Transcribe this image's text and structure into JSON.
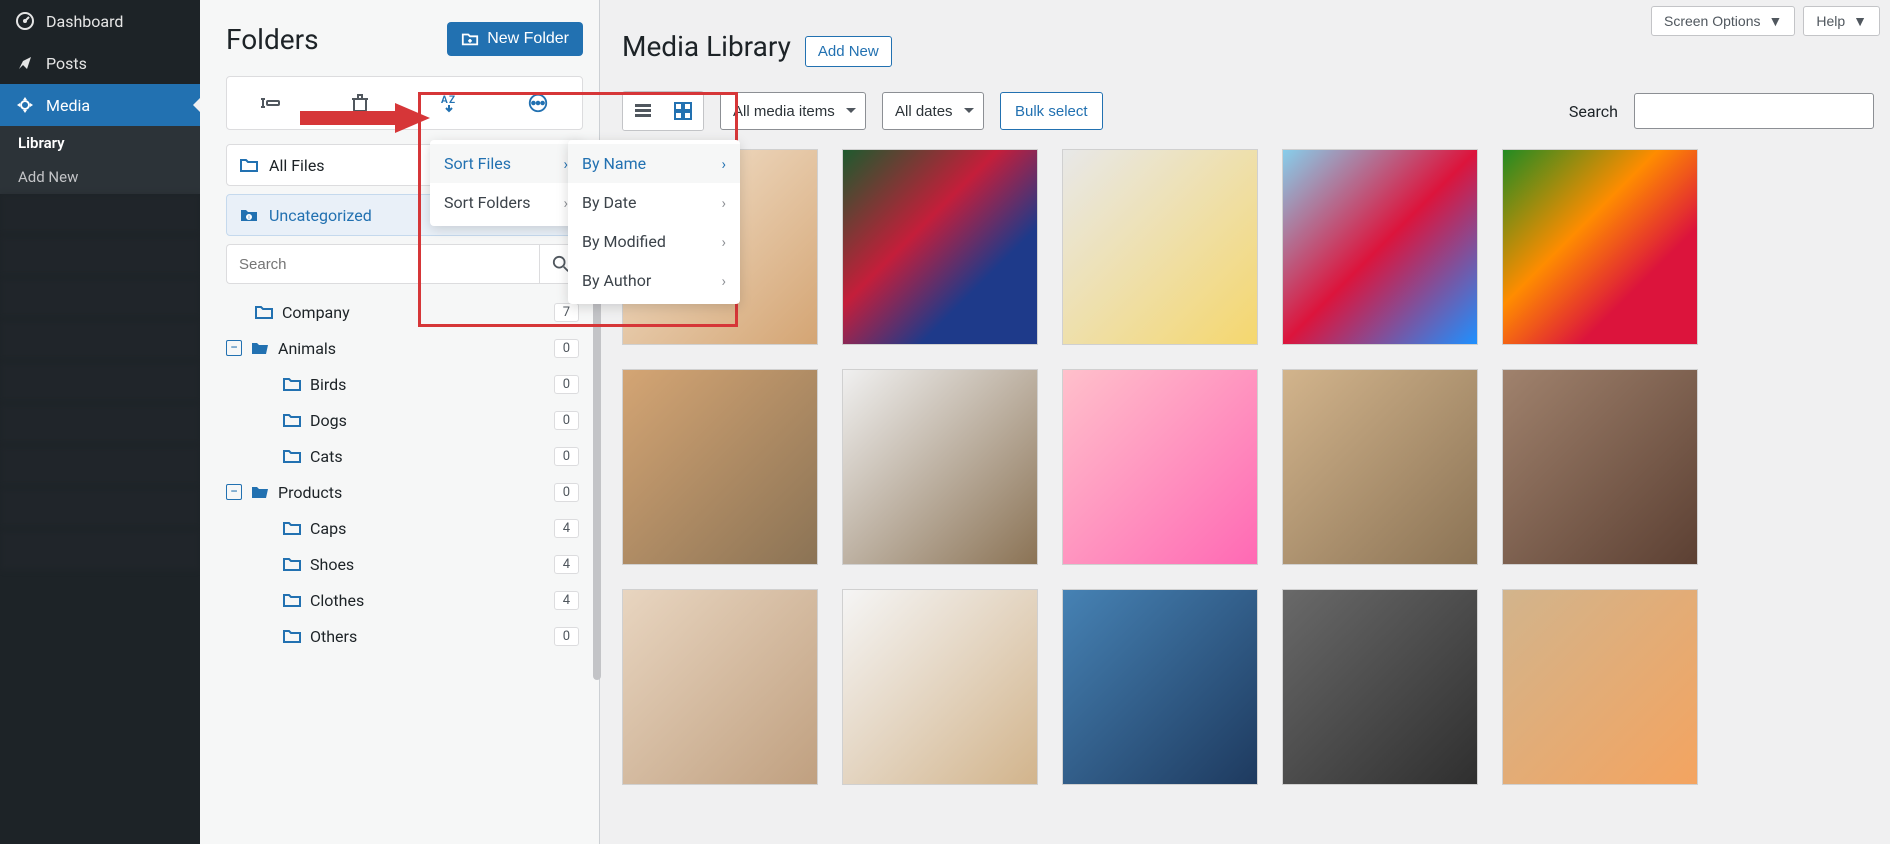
{
  "admin_menu": {
    "dashboard": "Dashboard",
    "posts": "Posts",
    "media": "Media",
    "library": "Library",
    "add_new": "Add New"
  },
  "folders": {
    "title": "Folders",
    "new_folder_btn": "New Folder",
    "all_files": "All Files",
    "uncategorized": "Uncategorized",
    "search_placeholder": "Search",
    "tree": {
      "company": {
        "label": "Company",
        "count": "7"
      },
      "animals": {
        "label": "Animals",
        "count": "0"
      },
      "birds": {
        "label": "Birds",
        "count": "0"
      },
      "dogs": {
        "label": "Dogs",
        "count": "0"
      },
      "cats": {
        "label": "Cats",
        "count": "0"
      },
      "products": {
        "label": "Products",
        "count": "0"
      },
      "caps": {
        "label": "Caps",
        "count": "4"
      },
      "shoes": {
        "label": "Shoes",
        "count": "4"
      },
      "clothes": {
        "label": "Clothes",
        "count": "4"
      },
      "others": {
        "label": "Others",
        "count": "0"
      }
    }
  },
  "sort_popup1": {
    "sort_files": "Sort Files",
    "sort_folders": "Sort Folders"
  },
  "sort_popup2": {
    "by_name": "By Name",
    "by_date": "By Date",
    "by_modified": "By Modified",
    "by_author": "By Author"
  },
  "main": {
    "screen_options": "Screen Options",
    "help": "Help",
    "title": "Media Library",
    "add_new_btn": "Add New",
    "filter_media": "All media items",
    "filter_dates": "All dates",
    "bulk_select": "Bulk select",
    "search_label": "Search"
  }
}
